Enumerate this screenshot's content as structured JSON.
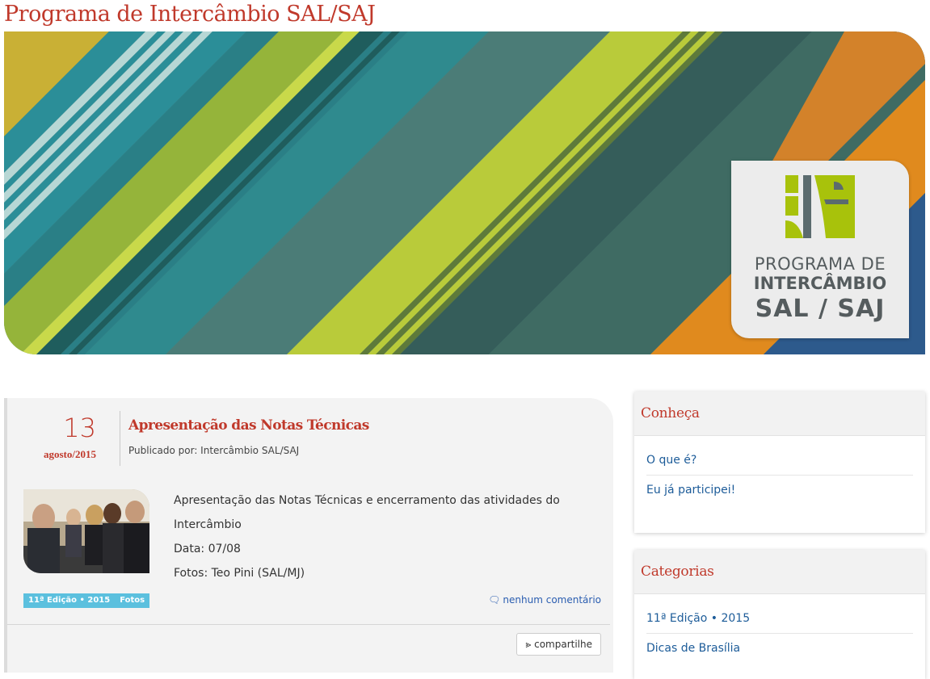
{
  "site": {
    "title": "Programa de Intercâmbio SAL/SAJ"
  },
  "banner": {
    "logo_lines": [
      "PROGRAMA DE",
      "INTERCÂMBIO",
      "SAL / SAJ"
    ]
  },
  "post": {
    "day": "13",
    "month_year": "agosto/2015",
    "title": "Apresentação das Notas Técnicas",
    "meta": "Publicado por: Intercâmbio SAL/SAJ",
    "paragraphs": [
      "Apresentação das Notas Técnicas e encerramento das atividades do Intercâmbio",
      "Data: 07/08",
      "Fotos: Teo Pini (SAL/MJ)"
    ],
    "tags": [
      "11ª Edição • 2015",
      "Fotos"
    ],
    "comments": "nenhum comentário",
    "share": "compartilhe"
  },
  "sidebar": {
    "conheca": {
      "title": "Conheça",
      "items": [
        "O que é?",
        "Eu já participei!"
      ]
    },
    "categorias": {
      "title": "Categorias",
      "items": [
        "11ª Edição • 2015",
        "Dicas de Brasília"
      ]
    }
  },
  "colors": {
    "accent": "#c0392b",
    "link": "#1d5c99",
    "tag": "#5bc0de"
  }
}
